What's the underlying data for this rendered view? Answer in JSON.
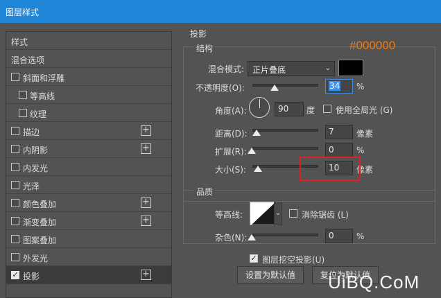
{
  "window": {
    "title": "图层样式"
  },
  "sidebar": {
    "items": [
      {
        "label": "样式",
        "has_checkbox": false,
        "has_plus": false
      },
      {
        "label": "混合选项",
        "has_checkbox": false,
        "has_plus": false
      },
      {
        "label": "斜面和浮雕",
        "has_checkbox": true,
        "checked": false,
        "has_plus": false
      },
      {
        "label": "等高线",
        "has_checkbox": true,
        "checked": false,
        "has_plus": false,
        "indent": true
      },
      {
        "label": "纹理",
        "has_checkbox": true,
        "checked": false,
        "has_plus": false,
        "indent": true
      },
      {
        "label": "描边",
        "has_checkbox": true,
        "checked": false,
        "has_plus": true
      },
      {
        "label": "内阴影",
        "has_checkbox": true,
        "checked": false,
        "has_plus": true
      },
      {
        "label": "内发光",
        "has_checkbox": true,
        "checked": false,
        "has_plus": false
      },
      {
        "label": "光泽",
        "has_checkbox": true,
        "checked": false,
        "has_plus": false
      },
      {
        "label": "颜色叠加",
        "has_checkbox": true,
        "checked": false,
        "has_plus": true
      },
      {
        "label": "渐变叠加",
        "has_checkbox": true,
        "checked": false,
        "has_plus": true
      },
      {
        "label": "图案叠加",
        "has_checkbox": true,
        "checked": false,
        "has_plus": false
      },
      {
        "label": "外发光",
        "has_checkbox": true,
        "checked": false,
        "has_plus": false
      },
      {
        "label": "投影",
        "has_checkbox": true,
        "checked": true,
        "has_plus": true,
        "active": true
      }
    ]
  },
  "panel": {
    "section_title": "投影",
    "structure": {
      "title": "结构",
      "blend_mode_label": "混合模式:",
      "blend_mode_value": "正片叠底",
      "color_hex_annotation": "#000000",
      "opacity_label": "不透明度(O):",
      "opacity_value": "34",
      "opacity_unit": "%",
      "angle_label": "角度(A):",
      "angle_value": "90",
      "angle_unit": "度",
      "global_light_label": "使用全局光 (G)",
      "distance_label": "距离(D):",
      "distance_value": "7",
      "distance_unit": "像素",
      "spread_label": "扩展(R):",
      "spread_value": "0",
      "spread_unit": "%",
      "size_label": "大小(S):",
      "size_value": "10",
      "size_unit": "像素"
    },
    "quality": {
      "title": "品质",
      "contour_label": "等高线:",
      "antialias_label": "消除锯齿 (L)",
      "noise_label": "杂色(N):",
      "noise_value": "0",
      "noise_unit": "%"
    },
    "knockout_label": "图层挖空投影(U)",
    "set_default_label": "设置为默认值",
    "reset_default_label": "复位为默认值"
  },
  "watermark": "UiBQ.CoM",
  "colors": {
    "titlebar": "#1f86d8",
    "panel_bg": "#535353",
    "swatch": "#000000",
    "hex_annotation": "#ec7a17",
    "highlight_box": "#e02020"
  }
}
